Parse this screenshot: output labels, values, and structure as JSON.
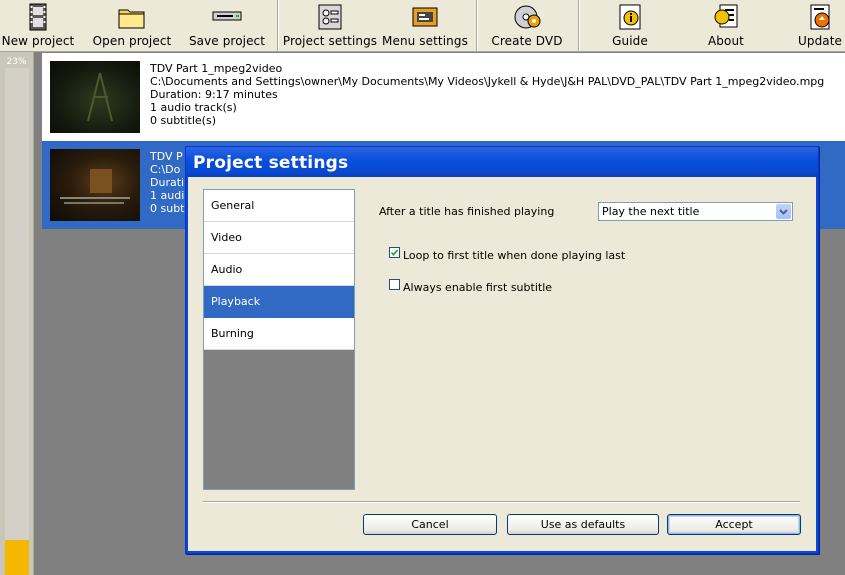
{
  "toolbar": {
    "buttons": [
      {
        "label": "New project",
        "icon": "film-icon"
      },
      {
        "label": "Open project",
        "icon": "folder-icon"
      },
      {
        "label": "Save project",
        "icon": "disk-drive-icon"
      },
      {
        "label": "Project settings",
        "icon": "settings-panel-icon"
      },
      {
        "label": "Menu settings",
        "icon": "menu-icon"
      },
      {
        "label": "Create DVD",
        "icon": "dvd-burn-icon"
      },
      {
        "label": "Guide",
        "icon": "guide-icon"
      },
      {
        "label": "About",
        "icon": "about-icon"
      },
      {
        "label": "Update",
        "icon": "update-icon"
      }
    ]
  },
  "progress": {
    "text": "23%",
    "fraction": 0.07
  },
  "titles": [
    {
      "name": "TDV  Part 1_mpeg2video",
      "path": "C:\\Documents and Settings\\owner\\My Documents\\My Videos\\Jykell & Hyde\\J&H PAL\\DVD_PAL\\TDV  Part 1_mpeg2video.mpg",
      "duration": "Duration: 9:17 minutes",
      "audio": "1 audio track(s)",
      "subtitles": "0 subtitle(s)"
    },
    {
      "name": "TDV P",
      "path": "C:\\Do",
      "duration": "Durati",
      "audio": "1 audi",
      "subtitles": "0 subt"
    }
  ],
  "dialog": {
    "title": "Project settings",
    "categories": [
      "General",
      "Video",
      "Audio",
      "Playback",
      "Burning"
    ],
    "active_category": "Playback",
    "playback": {
      "after_title_label": "After a title has finished playing",
      "after_title_value": "Play the next title",
      "loop_label": "Loop to first title when done playing last",
      "loop_checked": true,
      "subtitle_label": "Always enable first subtitle",
      "subtitle_checked": false
    },
    "buttons": {
      "cancel": "Cancel",
      "defaults": "Use as defaults",
      "accept": "Accept"
    }
  },
  "colors": {
    "selection": "#316ac5",
    "titlebar": "#0a4edc",
    "progress": "#f5b800"
  }
}
